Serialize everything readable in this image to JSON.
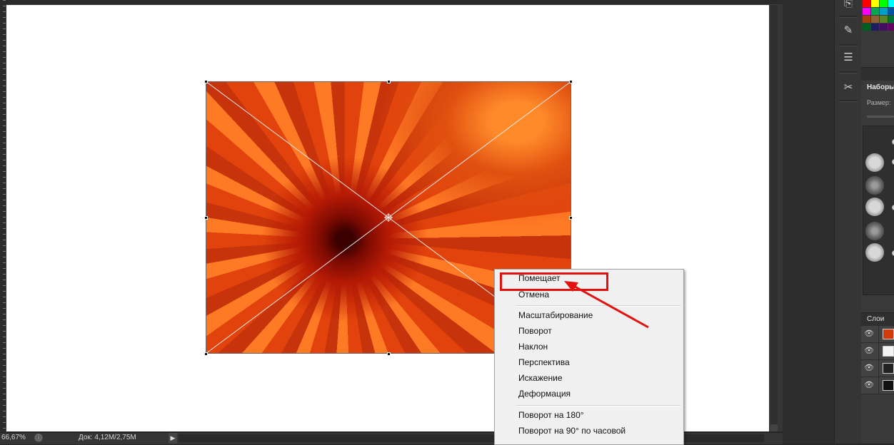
{
  "status": {
    "zoom": "66,67%",
    "doc_info": "Док: 4,12M/2,75M",
    "play_icon": "▶"
  },
  "right_panel": {
    "brushes_title": "Наборы",
    "brushes_size_label": "Размер:",
    "layers_tab": "Слои"
  },
  "context_menu": {
    "items": [
      "Помещает",
      "Отмена",
      "Масштабирование",
      "Поворот",
      "Наклон",
      "Перспектива",
      "Искажение",
      "Деформация",
      "Поворот на 180°",
      "Поворот на 90° по часовой"
    ]
  },
  "icons": {
    "eye": "👁",
    "zoom_info": "ⓘ"
  },
  "colors": {
    "annotation": "#e31010",
    "canvas": "#ffffff",
    "workspace": "#282828"
  }
}
